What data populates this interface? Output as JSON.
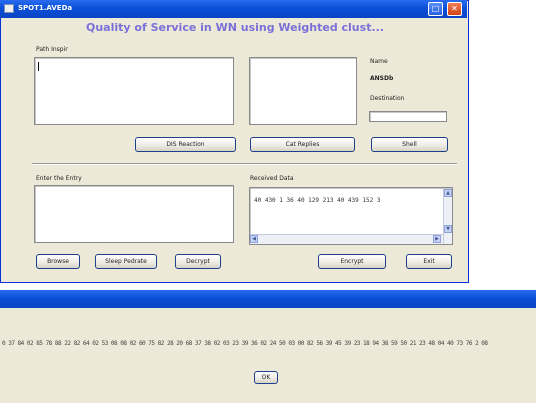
{
  "window": {
    "title": "SPOT1.AVEDa",
    "heading": "Quality of Service in WN using Weighted clust..."
  },
  "top": {
    "path_label": "Path Inspir",
    "name_label": "Name",
    "name_value": "ANSDb",
    "destination_label": "Destination",
    "destination_value": "",
    "buttons": [
      "DIS Reaction",
      "Cat Replies",
      "Shell"
    ]
  },
  "bottom": {
    "enter_label": "Enter the Entry",
    "received_label": "Received Data",
    "received_text": "40 430 1 36 40 129 213 40 439 152 3",
    "buttons": [
      "Browse",
      "Sleep Pedrate",
      "Decrypt",
      "Encrypt",
      "Exit"
    ]
  },
  "dialog": {
    "message": "0 37 84 02 85 78 88 22 82 64 02 53 08 08 02 60 75 82 28 20 68 37 38 02 03 23 39 36 02 24 50 03 00 82 56 39 45 39 23 18 94 38 59 50 21 23 48 04 40 73 76 2 08",
    "ok_label": "OK"
  }
}
